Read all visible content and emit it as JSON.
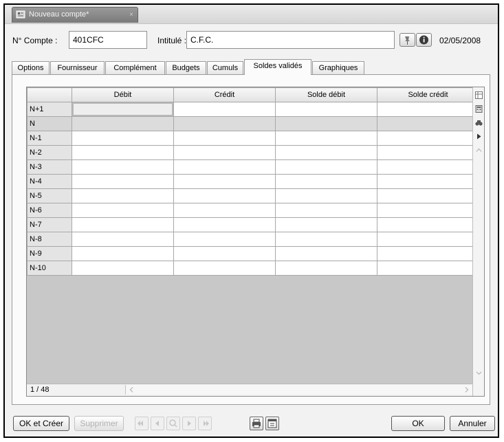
{
  "window": {
    "tab_title": "Nouveau compte*",
    "close_glyph": "×"
  },
  "header": {
    "account_label": "N° Compte :",
    "account_value": "401CFC",
    "title_label": "Intitulé :",
    "title_value": "C.F.C.",
    "date": "02/05/2008"
  },
  "tabs": [
    {
      "label": "Options"
    },
    {
      "label": "Fournisseur"
    },
    {
      "label": "Complément"
    },
    {
      "label": "Budgets"
    },
    {
      "label": "Cumuls"
    },
    {
      "label": "Soldes validés",
      "active": true
    },
    {
      "label": "Graphiques"
    }
  ],
  "grid": {
    "columns": [
      "",
      "Débit",
      "Crédit",
      "Solde débit",
      "Solde crédit"
    ],
    "rows": [
      "N+1",
      "N",
      "N-1",
      "N-2",
      "N-3",
      "N-4",
      "N-5",
      "N-6",
      "N-7",
      "N-8",
      "N-9",
      "N-10"
    ],
    "selected_row": "N"
  },
  "status": {
    "counter": "1 / 48"
  },
  "footer": {
    "ok_create": "OK et Créer",
    "delete": "Supprimer",
    "ok": "OK",
    "cancel": "Annuler"
  },
  "icons": {
    "header": [
      "pin-icon",
      "info-icon"
    ],
    "side": [
      "grid-settings-icon",
      "calculator-icon",
      "binoculars-icon",
      "play-icon",
      "collapse-up-icon"
    ],
    "nav": [
      "first-record-icon",
      "previous-record-icon",
      "search-record-icon",
      "next-record-icon",
      "last-record-icon"
    ],
    "tools": [
      "print-icon",
      "calendar-icon"
    ]
  },
  "colors": {
    "window_bg": "#f2f2f2",
    "grid_empty": "#c8c8c8",
    "title_tab": "#8a8a8a"
  }
}
